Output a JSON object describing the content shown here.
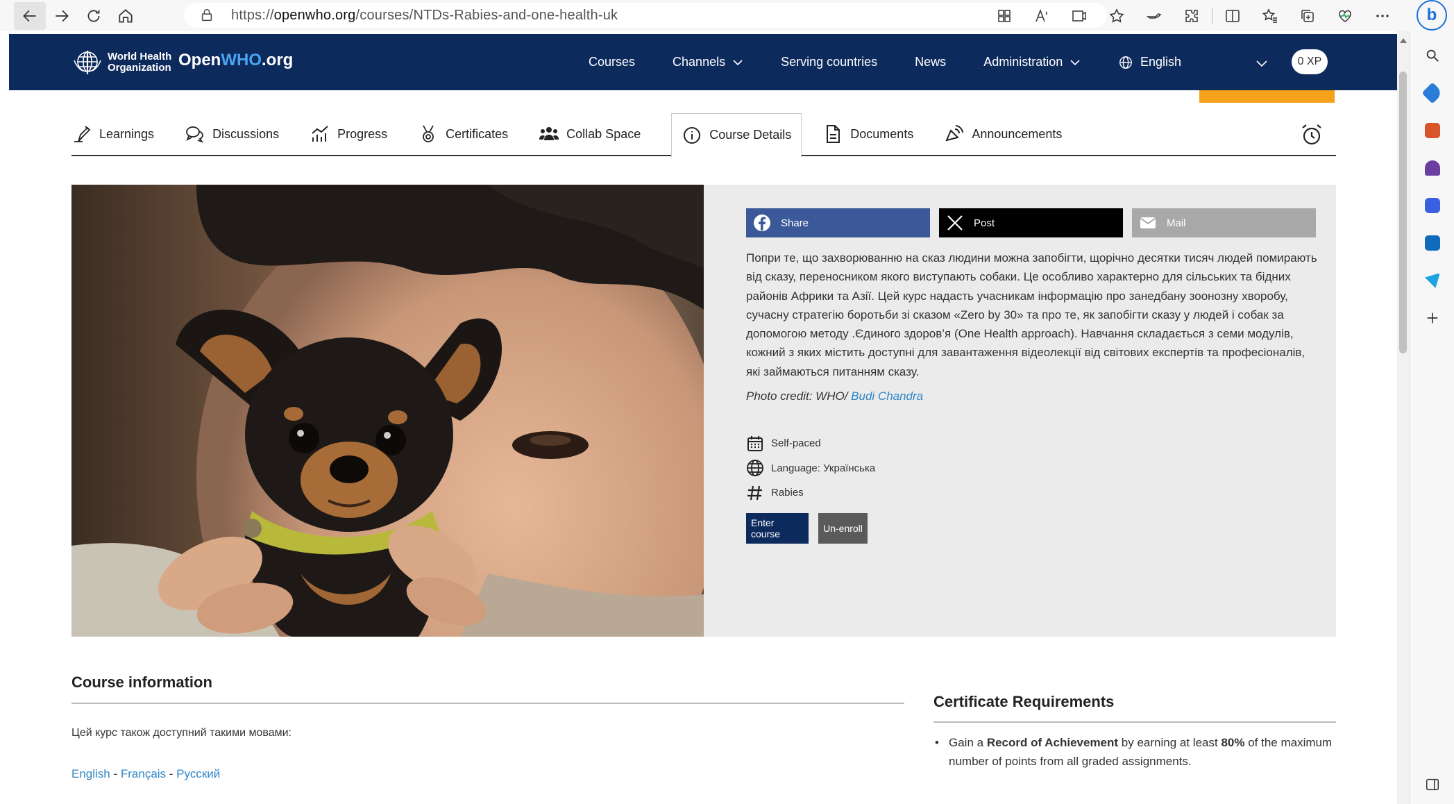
{
  "browser": {
    "url_prefix": "https://",
    "url_domain": "openwho.org",
    "url_path": "/courses/NTDs-Rabies-and-one-health-uk"
  },
  "header": {
    "logo_text_line1": "World Health",
    "logo_text_line2": "Organization",
    "brand_part1": "Open",
    "brand_part2": "WHO",
    "brand_part3": ".org",
    "nav": {
      "courses": "Courses",
      "channels": "Channels",
      "serving_countries": "Serving countries",
      "news": "News",
      "administration": "Administration"
    },
    "language": "English",
    "xp": "0 XP"
  },
  "tabs": [
    {
      "label": "Learnings",
      "icon": "learnings-icon"
    },
    {
      "label": "Discussions",
      "icon": "discussions-icon"
    },
    {
      "label": "Progress",
      "icon": "progress-icon"
    },
    {
      "label": "Certificates",
      "icon": "certificate-icon"
    },
    {
      "label": "Collab Space",
      "icon": "collab-icon"
    },
    {
      "label": "Course Details",
      "icon": "info-icon",
      "active": true
    },
    {
      "label": "Documents",
      "icon": "document-icon"
    },
    {
      "label": "Announcements",
      "icon": "announcement-icon"
    }
  ],
  "share": {
    "facebook": "Share",
    "x": "Post",
    "mail": "Mail"
  },
  "course": {
    "description": "Попри те, що захворюванню на сказ людини можна запобігти, щорічно десятки тисяч людей помирають від сказу, переносником якого виступають собаки. Це особливо характерно для сільських та бідних районів Африки та Азії. Цей курс надасть учасникам інформацію про занедбану зоонозну хворобу, сучасну стратегію боротьби зі сказом «Zero by 30» та про те, як запобігти сказу у людей і собак за допомогою методу .Єдиного здоров’я (One Health approach). Навчання складається з семи модулів, кожний з яких містить доступні для завантаження відеолекції від світових експертів та професіоналів, які займаються питанням сказу.",
    "photo_credit_prefix": "Photo credit: WHO/ ",
    "photo_credit_name": "Budi Chandra",
    "pace": "Self-paced",
    "language": "Language: Українська",
    "topic": "Rabies",
    "enter_button": "Enter course",
    "unenroll_button": "Un-enroll"
  },
  "course_information": {
    "title": "Course information",
    "available_text": "Цей курс також доступний такими мовами:",
    "languages": [
      "English",
      "Français",
      "Русский"
    ],
    "separator": " - "
  },
  "certificate": {
    "title": "Certificate Requirements",
    "text_1": "Gain a ",
    "bold_1": "Record of Achievement",
    "text_2": " by earning at least ",
    "bold_2": "80%",
    "text_3": " of the maximum number of points from all graded assignments."
  },
  "colors": {
    "header_bg": "#0d2a5c",
    "accent_orange": "#f5a31a",
    "link_blue": "#2f86c8",
    "facebook": "#3b5998"
  }
}
